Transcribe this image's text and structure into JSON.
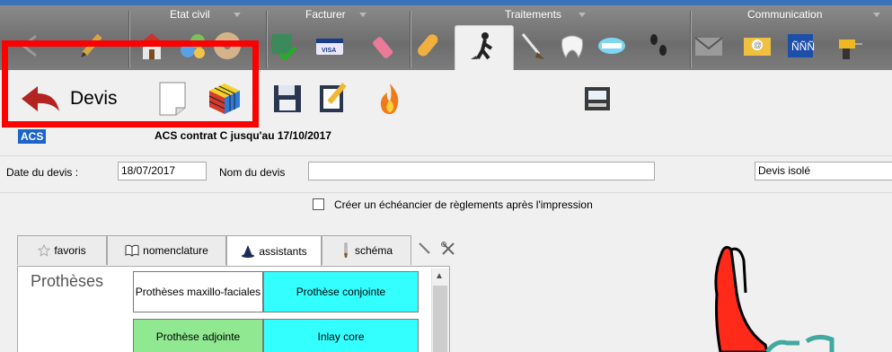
{
  "window": {
    "accent": "#3b73b9",
    "toolbar_bg": "#7a7a7a"
  },
  "toolbar_groups": [
    {
      "label": "Etat civil"
    },
    {
      "label": "Facturer"
    },
    {
      "label": "Traitements"
    },
    {
      "label": "Communication"
    }
  ],
  "toolbar_icons": [
    "back-arrow-icon",
    "pencil-icon",
    "house-icon",
    "puzzle-icon",
    "cd-icon",
    "invoice-check-icon",
    "visa-card-icon",
    "eraser-icon",
    "pill-icon",
    "worker-dig-icon",
    "brush-icon",
    "tooth-icon",
    "dentures-icon",
    "footprints-icon",
    "envelope-icon",
    "email-icon",
    "contacts-icon",
    "drill-icon"
  ],
  "devis_toolbar": {
    "devis_label": "Devis",
    "icons": [
      "back-arrow-icon",
      "blank-page-icon",
      "rubiks-cube-icon",
      "floppy-save-icon",
      "edit-pencil-icon",
      "flame-icon",
      "scanner-icon"
    ],
    "highlight_color": "#ff0000"
  },
  "acs": {
    "badge": "ACS",
    "text": "ACS contrat C jusqu'au 17/10/2017",
    "badge_color": "#1d64c8"
  },
  "form": {
    "date_label": "Date du devis :",
    "date_value": "18/07/2017",
    "name_label": "Nom du devis",
    "name_value": "",
    "type_value": "Devis isolé",
    "schedule_checkbox_label": "Créer un échéancier de règlements après l'impression",
    "schedule_checked": false
  },
  "tabs": [
    {
      "label": "favoris",
      "icon": "star-icon",
      "active": false
    },
    {
      "label": "nomenclature",
      "icon": "book-icon",
      "active": false
    },
    {
      "label": "assistants",
      "icon": "wizard-hat-icon",
      "active": true
    },
    {
      "label": "schéma",
      "icon": "brush-icon",
      "active": false
    }
  ],
  "extra_tab_icons": [
    "pen-icon",
    "tools-icon"
  ],
  "assistants_panel": {
    "title": "Prothèses",
    "buttons": [
      {
        "label": "Prothèses maxillo-faciales",
        "color": "#ffffff"
      },
      {
        "label": "Prothèse conjointe",
        "color": "#33ffff"
      },
      {
        "label": "Prothèse adjointe",
        "color": "#90e890"
      },
      {
        "label": "Inlay core",
        "color": "#33ffff"
      }
    ]
  },
  "drawing": {
    "fill": "#ff2a1a",
    "stroke": "#000000",
    "accent": "#3fa9a0"
  }
}
